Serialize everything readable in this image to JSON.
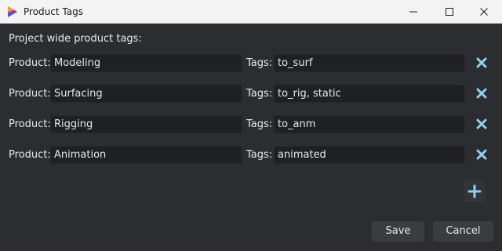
{
  "window": {
    "title": "Product Tags"
  },
  "heading": "Project wide product tags:",
  "labels": {
    "product": "Product:",
    "tags": "Tags:"
  },
  "rows": [
    {
      "product": "Modeling",
      "tags": "to_surf"
    },
    {
      "product": "Surfacing",
      "tags": "to_rig, static"
    },
    {
      "product": "Rigging",
      "tags": "to_anm"
    },
    {
      "product": "Animation",
      "tags": "animated"
    }
  ],
  "icons": {
    "remove": "close-x-icon",
    "add": "plus-icon",
    "app": "app-logo-icon"
  },
  "colors": {
    "accent": "#8fd0f2",
    "background": "#2b2d30",
    "field": "#1f2023"
  },
  "buttons": {
    "save": "Save",
    "cancel": "Cancel"
  }
}
